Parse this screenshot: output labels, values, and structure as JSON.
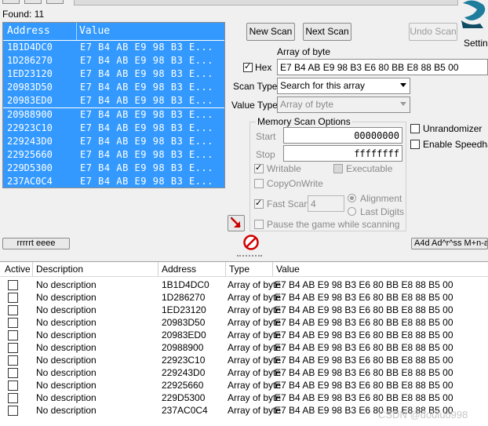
{
  "found": {
    "label": "Found: 11",
    "columns": {
      "address": "Address",
      "value": "Value"
    },
    "rows": [
      {
        "address": "1B1D4DC0",
        "value": "E7 B4 AB E9 98 B3 E..."
      },
      {
        "address": "1D286270",
        "value": "E7 B4 AB E9 98 B3 E..."
      },
      {
        "address": "1ED23120",
        "value": "E7 B4 AB E9 98 B3 E..."
      },
      {
        "address": "20983D50",
        "value": "E7 B4 AB E9 98 B3 E..."
      },
      {
        "address": "20983ED0",
        "value": "E7 B4 AB E9 98 B3 E..."
      },
      {
        "address": "20988900",
        "value": "E7 B4 AB E9 98 B3 E..."
      },
      {
        "address": "22923C10",
        "value": "E7 B4 AB E9 98 B3 E..."
      },
      {
        "address": "229243D0",
        "value": "E7 B4 AB E9 98 B3 E..."
      },
      {
        "address": "22925660",
        "value": "E7 B4 AB E9 98 B3 E..."
      },
      {
        "address": "229D5300",
        "value": "E7 B4 AB E9 98 B3 E..."
      },
      {
        "address": "237AC0C4",
        "value": "E7 B4 AB E9 98 B3 E..."
      }
    ]
  },
  "scan": {
    "new_scan": "New Scan",
    "next_scan": "Next Scan",
    "undo_scan": "Undo Scan",
    "settings": "Setting",
    "value_type_caption": "Array of byte",
    "hex_label": "Hex",
    "hex_checked": true,
    "value_input": "E7 B4 AB E9 98 B3 E6 80 BB E8 88 B5 00",
    "scan_type_label": "Scan Type",
    "scan_type_value": "Search for this array",
    "value_type_label": "Value Type",
    "value_type_value": "Array of byte",
    "memory_options_label": "Memory Scan Options",
    "start_label": "Start",
    "start_value": "00000000",
    "stop_label": "Stop",
    "stop_value": "ffffffff",
    "writable_label": "Writable",
    "executable_label": "Executable",
    "copyonwrite_label": "CopyOnWrite",
    "fast_scan_label": "Fast Scan",
    "fast_scan_value": "4",
    "alignment_label": "Alignment",
    "last_digits_label": "Last Digits",
    "pause_label": "Pause the game while scanning",
    "unrandomizer_label": "Unrandomizer",
    "speedhack_label": "Enable Speedhac"
  },
  "bottom_bar": {
    "memory_view_button": "rrrrrt eeee",
    "add_address_button": "A4d Ad^r^ss M+n-all"
  },
  "address_list": {
    "columns": {
      "active": "Active",
      "description": "Description",
      "address": "Address",
      "type": "Type",
      "value": "Value"
    },
    "rows": [
      {
        "description": "No description",
        "address": "1B1D4DC0",
        "type": "Array of byte",
        "value": "E7 B4 AB E9 98 B3 E6 80 BB E8 88 B5 00"
      },
      {
        "description": "No description",
        "address": "1D286270",
        "type": "Array of byte",
        "value": "E7 B4 AB E9 98 B3 E6 80 BB E8 88 B5 00"
      },
      {
        "description": "No description",
        "address": "1ED23120",
        "type": "Array of byte",
        "value": "E7 B4 AB E9 98 B3 E6 80 BB E8 88 B5 00"
      },
      {
        "description": "No description",
        "address": "20983D50",
        "type": "Array of byte",
        "value": "E7 B4 AB E9 98 B3 E6 80 BB E8 88 B5 00"
      },
      {
        "description": "No description",
        "address": "20983ED0",
        "type": "Array of byte",
        "value": "E7 B4 AB E9 98 B3 E6 80 BB E8 88 B5 00"
      },
      {
        "description": "No description",
        "address": "20988900",
        "type": "Array of byte",
        "value": "E7 B4 AB E9 98 B3 E6 80 BB E8 88 B5 00"
      },
      {
        "description": "No description",
        "address": "22923C10",
        "type": "Array of byte",
        "value": "E7 B4 AB E9 98 B3 E6 80 BB E8 88 B5 00"
      },
      {
        "description": "No description",
        "address": "229243D0",
        "type": "Array of byte",
        "value": "E7 B4 AB E9 98 B3 E6 80 BB E8 88 B5 00"
      },
      {
        "description": "No description",
        "address": "22925660",
        "type": "Array of byte",
        "value": "E7 B4 AB E9 98 B3 E6 80 BB E8 88 B5 00"
      },
      {
        "description": "No description",
        "address": "229D5300",
        "type": "Array of byte",
        "value": "E7 B4 AB E9 98 B3 E6 80 BB E8 88 B5 00"
      },
      {
        "description": "No description",
        "address": "237AC0C4",
        "type": "Array of byte",
        "value": "E7 B4 AB E9 98 B3 E6 80 BB E8 88 B5 00"
      }
    ]
  },
  "watermark": "CSDN @douluo998",
  "colors": {
    "selection": "#3399ff",
    "window": "#f0f0f0"
  }
}
